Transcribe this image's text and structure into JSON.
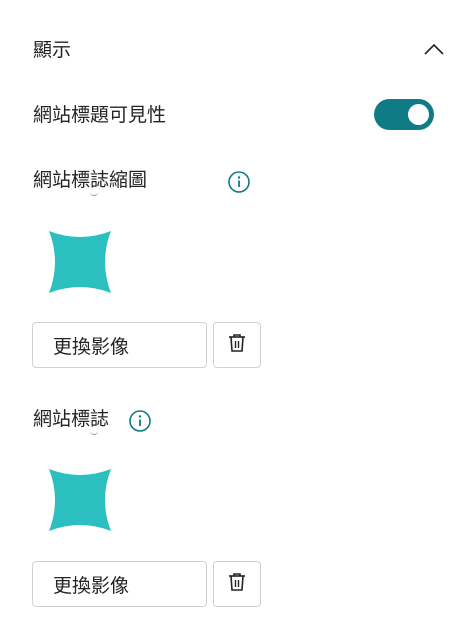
{
  "panel": {
    "section_title": "顯示",
    "site_title_visibility_label": "網站標題可見性",
    "site_title_visibility_on": true,
    "thumbnail_label": "網站標誌縮圖",
    "logo_label": "網站標誌",
    "change_image_label": "更換影像"
  },
  "colors": {
    "accent": "#0f7b84",
    "logo": "#2bbfc0"
  }
}
